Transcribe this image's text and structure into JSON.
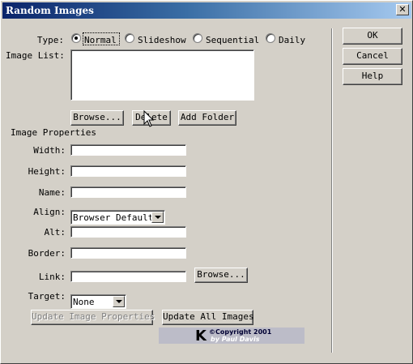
{
  "window": {
    "title": "Random Images",
    "close_glyph": "✕"
  },
  "type_group": {
    "label": "Type:",
    "options": [
      {
        "label": "Normal",
        "checked": true
      },
      {
        "label": "Slideshow",
        "checked": false
      },
      {
        "label": "Sequential",
        "checked": false
      },
      {
        "label": "Daily",
        "checked": false
      }
    ]
  },
  "image_list": {
    "label": "Image List:"
  },
  "list_buttons": {
    "browse": "Browse...",
    "delete": "Delete",
    "add_folder": "Add Folder"
  },
  "properties": {
    "heading": "Image Properties",
    "width_label": "Width:",
    "height_label": "Height:",
    "name_label": "Name:",
    "align_label": "Align:",
    "align_value": "Browser Default",
    "alt_label": "Alt:",
    "border_label": "Border:",
    "link_label": "Link:",
    "link_browse": "Browse...",
    "target_label": "Target:",
    "target_value": "None",
    "width_value": "",
    "height_value": "",
    "name_value": "",
    "alt_value": "",
    "border_value": "",
    "link_value": ""
  },
  "update_buttons": {
    "update_image": "Update Image Properties",
    "update_all": "Update All Images"
  },
  "dialog_buttons": {
    "ok": "OK",
    "cancel": "Cancel",
    "help": "Help"
  },
  "logo": {
    "letter": "K",
    "line1": "©Copyright 2001",
    "line2": "by Paul Davis"
  },
  "colors": {
    "face": "#d4d0c8",
    "title_start": "#0a246a",
    "title_end": "#a6caf0",
    "disabled_text": "#808080"
  },
  "icons": {
    "close": "close-icon",
    "cursor": "mouse-pointer-icon"
  }
}
